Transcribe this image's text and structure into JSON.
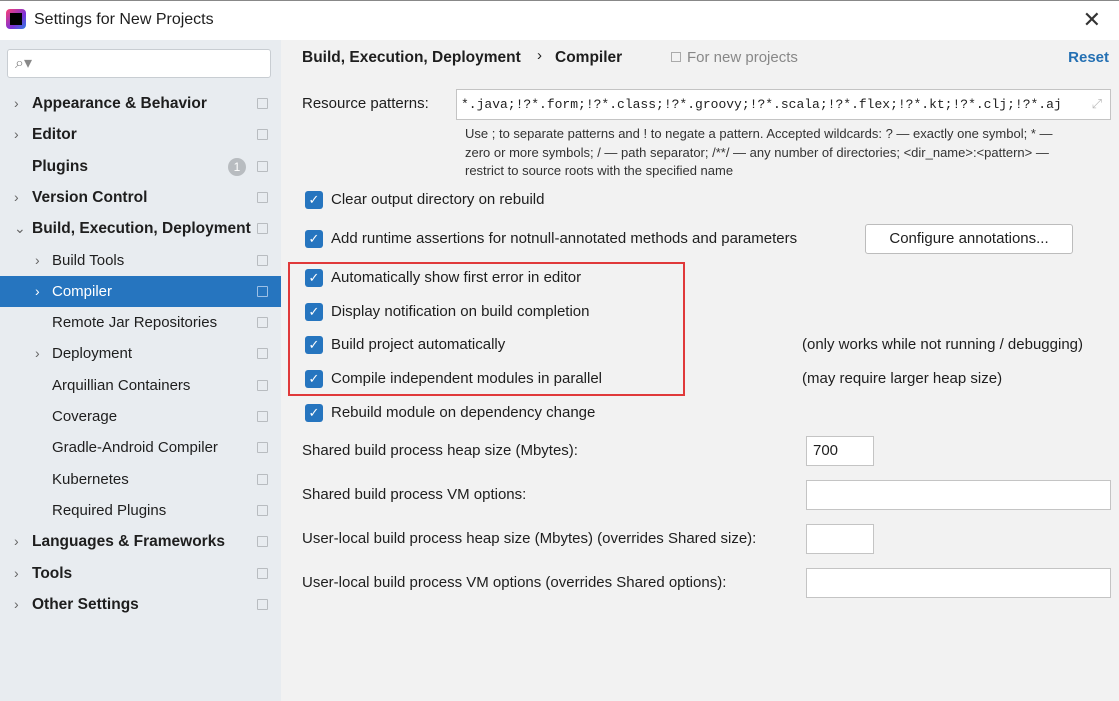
{
  "window": {
    "title": "Settings for New Projects",
    "close": "✕"
  },
  "search": {
    "placeholder": "",
    "icon": "search-icon"
  },
  "sidebar": {
    "items": [
      {
        "label": "Appearance & Behavior",
        "bold": true,
        "chevron": "›",
        "indent": 0
      },
      {
        "label": "Editor",
        "bold": true,
        "chevron": "›",
        "indent": 0
      },
      {
        "label": "Plugins",
        "bold": true,
        "chevron": "",
        "indent": 0,
        "badge": "1"
      },
      {
        "label": "Version Control",
        "bold": true,
        "chevron": "›",
        "indent": 0
      },
      {
        "label": "Build, Execution, Deployment",
        "bold": true,
        "chevron": "⌄",
        "indent": 0
      },
      {
        "label": "Build Tools",
        "bold": false,
        "chevron": "›",
        "indent": 1
      },
      {
        "label": "Compiler",
        "bold": false,
        "chevron": "›",
        "indent": 1,
        "selected": true
      },
      {
        "label": "Remote Jar Repositories",
        "bold": false,
        "chevron": "",
        "indent": 1
      },
      {
        "label": "Deployment",
        "bold": false,
        "chevron": "›",
        "indent": 1
      },
      {
        "label": "Arquillian Containers",
        "bold": false,
        "chevron": "",
        "indent": 1
      },
      {
        "label": "Coverage",
        "bold": false,
        "chevron": "",
        "indent": 1
      },
      {
        "label": "Gradle-Android Compiler",
        "bold": false,
        "chevron": "",
        "indent": 1
      },
      {
        "label": "Kubernetes",
        "bold": false,
        "chevron": "",
        "indent": 1
      },
      {
        "label": "Required Plugins",
        "bold": false,
        "chevron": "",
        "indent": 1
      },
      {
        "label": "Languages & Frameworks",
        "bold": true,
        "chevron": "›",
        "indent": 0
      },
      {
        "label": "Tools",
        "bold": true,
        "chevron": "›",
        "indent": 0
      },
      {
        "label": "Other Settings",
        "bold": true,
        "chevron": "›",
        "indent": 0
      }
    ]
  },
  "header": {
    "breadcrumb1": "Build, Execution, Deployment",
    "separator": "›",
    "breadcrumb2": "Compiler",
    "scope": "For new projects",
    "reset": "Reset"
  },
  "resource": {
    "label": "Resource patterns:",
    "value": "*.java;!?*.form;!?*.class;!?*.groovy;!?*.scala;!?*.flex;!?*.kt;!?*.clj;!?*.aj",
    "help1": "Use ; to separate patterns and ! to negate a pattern. Accepted wildcards: ? — exactly one symbol; * —",
    "help2": "zero or more symbols; / — path separator; /**/ — any number of directories; <dir_name>:<pattern> —",
    "help3": "restrict to source roots with the specified name"
  },
  "options": [
    {
      "label": "Clear output directory on rebuild",
      "checked": true
    },
    {
      "label": "Add runtime assertions for notnull-annotated methods and parameters",
      "checked": true
    },
    {
      "label": "Automatically show first error in editor",
      "checked": true
    },
    {
      "label": "Display notification on build completion",
      "checked": true
    },
    {
      "label": "Build project automatically",
      "checked": true,
      "note": "(only works while not running / debugging)"
    },
    {
      "label": "Compile independent modules in parallel",
      "checked": true,
      "note": "(may require larger heap size)"
    },
    {
      "label": "Rebuild module on dependency change",
      "checked": true
    }
  ],
  "configure_button": "Configure annotations...",
  "fields": [
    {
      "label": "Shared build process heap size (Mbytes):",
      "value": "700"
    },
    {
      "label": "Shared build process VM options:",
      "value": ""
    },
    {
      "label": "User-local build process heap size (Mbytes) (overrides Shared size):",
      "value": ""
    },
    {
      "label": "User-local build process VM options (overrides Shared options):",
      "value": ""
    }
  ],
  "colors": {
    "accent": "#2675bf",
    "highlight_box": "#e0393a",
    "link": "#2470b3"
  }
}
